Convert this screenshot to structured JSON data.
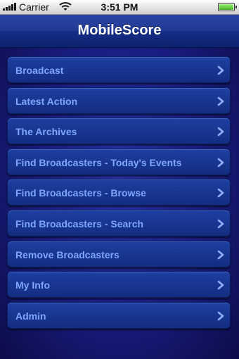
{
  "status_bar": {
    "carrier": "Carrier",
    "time": "3:51 PM",
    "battery_level": 1.0,
    "signal_bars": 5
  },
  "nav": {
    "title": "MobileScore"
  },
  "menu": {
    "items": [
      {
        "label": "Broadcast"
      },
      {
        "label": "Latest Action"
      },
      {
        "label": "The Archives"
      },
      {
        "label": "Find Broadcasters - Today's Events"
      },
      {
        "label": "Find Broadcasters - Browse"
      },
      {
        "label": "Find Broadcasters - Search"
      },
      {
        "label": "Remove Broadcasters"
      },
      {
        "label": "My Info"
      },
      {
        "label": "Admin"
      }
    ],
    "item_icon": "chevron-right-icon"
  },
  "colors": {
    "nav_bar": "#213a94",
    "button": "#183691",
    "button_text": "#7ea6ff",
    "background": "#1b1f86"
  }
}
